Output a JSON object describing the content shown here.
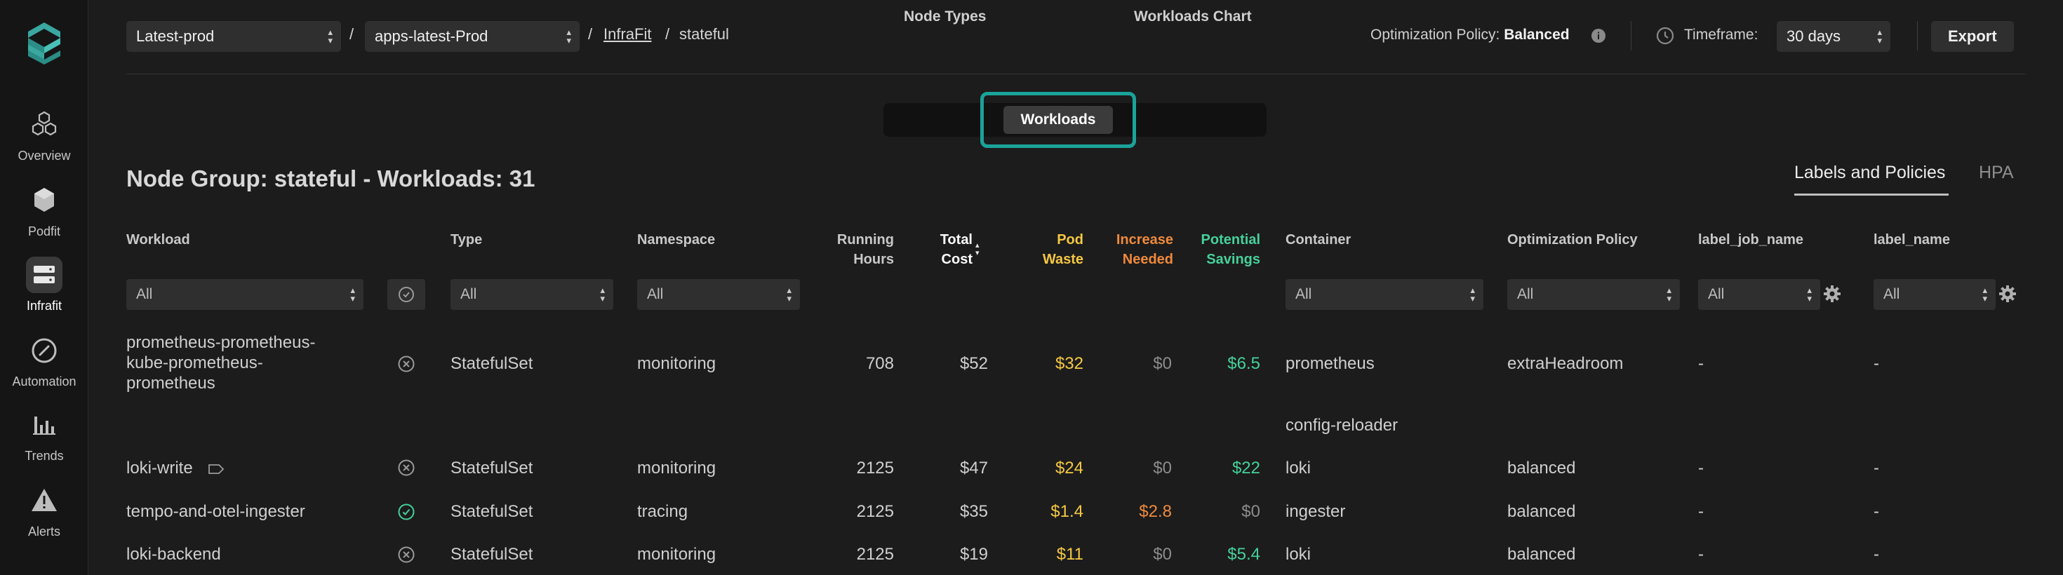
{
  "sidebar": {
    "items": [
      {
        "label": "Overview",
        "icon": "cubes-icon"
      },
      {
        "label": "Podfit",
        "icon": "cube-icon"
      },
      {
        "label": "Infrafit",
        "icon": "server-icon",
        "active": true
      },
      {
        "label": "Automation",
        "icon": "gauge-icon"
      },
      {
        "label": "Trends",
        "icon": "bar-chart-icon"
      },
      {
        "label": "Alerts",
        "icon": "warning-icon"
      }
    ]
  },
  "header": {
    "cluster_select": "Latest-prod",
    "app_select": "apps-latest-Prod",
    "sep": "/",
    "crumb_infrafit": "InfraFit",
    "crumb_stateful": "stateful",
    "policy_label": "Optimization Policy:",
    "policy_value": "Balanced",
    "timeframe_label": "Timeframe:",
    "timeframe_value": "30 days",
    "export_label": "Export"
  },
  "view_tabs": {
    "node_types": "Node Types",
    "workloads": "Workloads",
    "workloads_chart": "Workloads Chart",
    "active": "Workloads"
  },
  "page_title": "Node Group: stateful - Workloads: 31",
  "right_tabs": {
    "labels_policies": "Labels and Policies",
    "hpa": "HPA"
  },
  "table": {
    "headers": {
      "workload": "Workload",
      "type": "Type",
      "namespace": "Namespace",
      "running_hours": [
        "Running",
        "Hours"
      ],
      "total_cost": [
        "Total",
        "Cost"
      ],
      "pod_waste": [
        "Pod",
        "Waste"
      ],
      "increase_needed": [
        "Increase",
        "Needed"
      ],
      "potential_savings": [
        "Potential",
        "Savings"
      ],
      "container": "Container",
      "optimization_policy": "Optimization Policy",
      "label_job_name": "label_job_name",
      "label_name": "label_name"
    },
    "filter_all": "All",
    "colors": {
      "pod_waste": "#f5c842",
      "increase_needed": "#ef8a3c",
      "potential_savings": "#45d19b"
    },
    "rows": [
      {
        "workload": [
          "prometheus-prometheus-",
          "kube-prometheus-",
          "prometheus"
        ],
        "status": "x",
        "type": "StatefulSet",
        "namespace": "monitoring",
        "running_hours": "708",
        "total_cost": "$52",
        "pod_waste": "$32",
        "increase_needed": "$0",
        "potential_savings": "$6.5",
        "containers": [
          "prometheus",
          "config-reloader"
        ],
        "optimization_policy": "extraHeadroom",
        "label_job_name": "-",
        "label_name": "-"
      },
      {
        "workload": [
          "loki-write"
        ],
        "status": "x",
        "type": "StatefulSet",
        "namespace": "monitoring",
        "running_hours": "2125",
        "total_cost": "$47",
        "pod_waste": "$24",
        "increase_needed": "$0",
        "potential_savings": "$22",
        "containers": [
          "loki"
        ],
        "optimization_policy": "balanced",
        "label_job_name": "-",
        "label_name": "-"
      },
      {
        "workload": [
          "tempo-and-otel-ingester"
        ],
        "status": "check",
        "type": "StatefulSet",
        "namespace": "tracing",
        "running_hours": "2125",
        "total_cost": "$35",
        "pod_waste": "$1.4",
        "increase_needed": "$2.8",
        "potential_savings": "$0",
        "containers": [
          "ingester"
        ],
        "optimization_policy": "balanced",
        "label_job_name": "-",
        "label_name": "-"
      },
      {
        "workload": [
          "loki-backend"
        ],
        "status": "x",
        "type": "StatefulSet",
        "namespace": "monitoring",
        "running_hours": "2125",
        "total_cost": "$19",
        "pod_waste": "$11",
        "increase_needed": "$0",
        "potential_savings": "$5.4",
        "containers": [
          "loki"
        ],
        "optimization_policy": "balanced",
        "label_job_name": "-",
        "label_name": "-"
      }
    ]
  }
}
